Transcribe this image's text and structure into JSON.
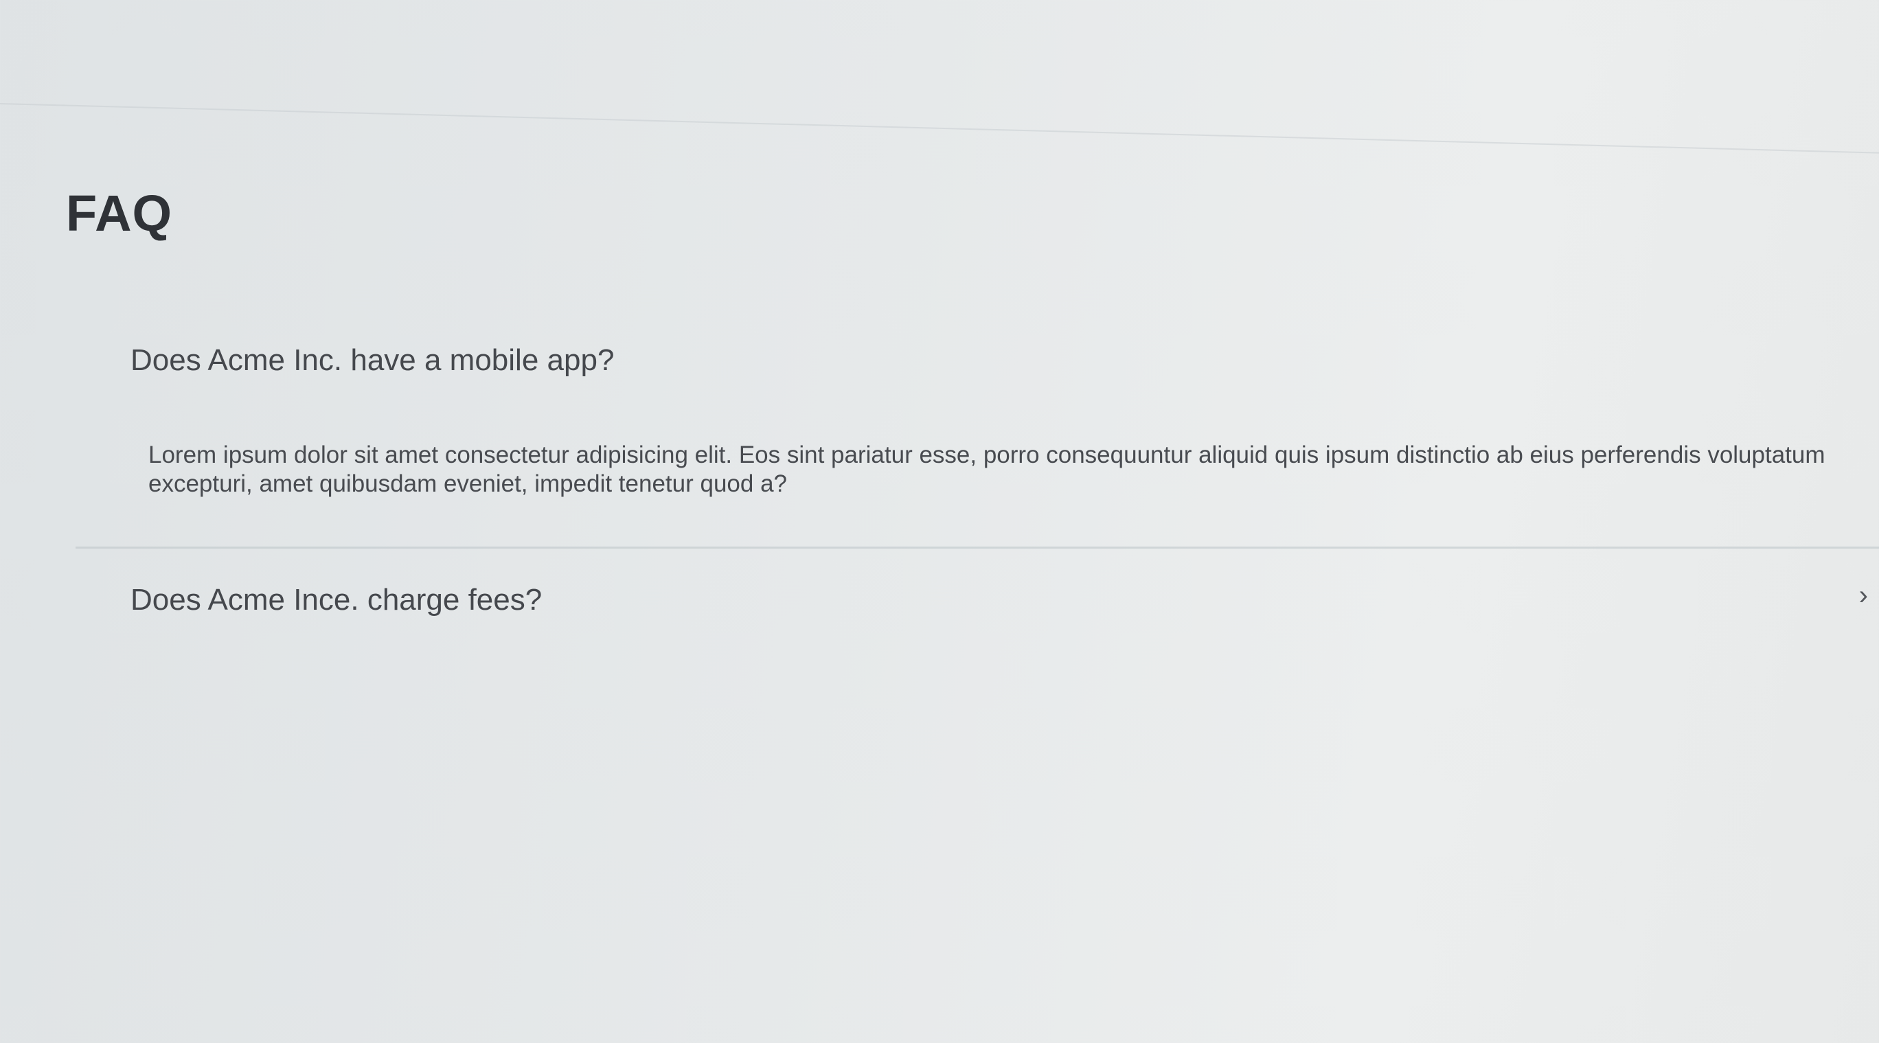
{
  "page": {
    "title": "FAQ"
  },
  "faq": {
    "items": [
      {
        "question": "Does Acme Inc. have a mobile app?",
        "answer": "Lorem ipsum dolor sit amet consectetur adipisicing elit. Eos sint pariatur esse, porro consequuntur aliquid quis ipsum distinctio ab eius perferendis voluptatum excepturi, amet quibusdam eveniet, impedit tenetur quod a?",
        "expanded": true
      },
      {
        "question": "Does Acme Ince. charge fees?",
        "expanded": false,
        "toggle_icon": "chevron-right-icon"
      }
    ]
  }
}
